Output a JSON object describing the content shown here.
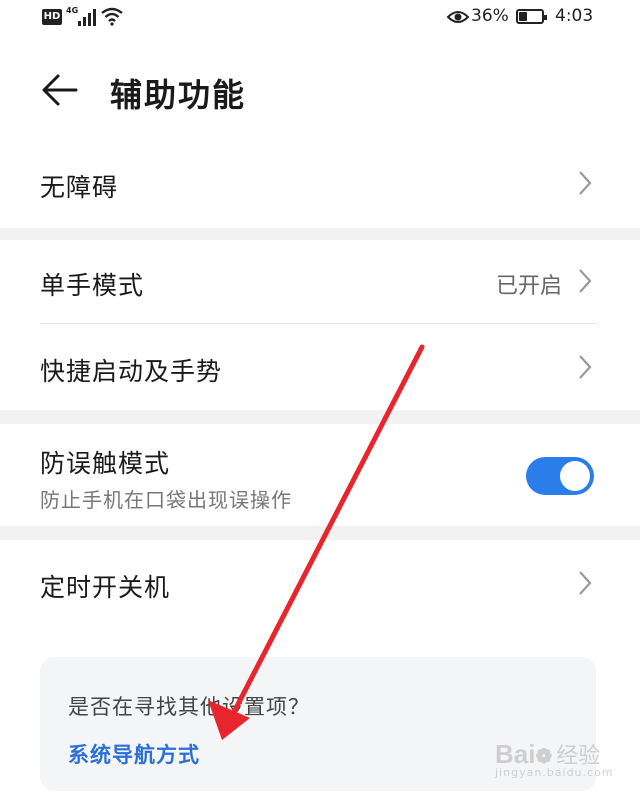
{
  "status_bar": {
    "hd": "HD",
    "network": "4G",
    "battery_percent": "36%",
    "battery_level": 0.36,
    "time": "4:03"
  },
  "header": {
    "title": "辅助功能",
    "back_icon": "arrow-left-icon"
  },
  "items": [
    {
      "label": "无障碍"
    },
    {
      "label": "单手模式",
      "value": "已开启"
    },
    {
      "label": "快捷启动及手势"
    },
    {
      "label": "防误触模式",
      "subtitle": "防止手机在口袋出现误操作",
      "toggle_on": true
    },
    {
      "label": "定时开关机"
    }
  ],
  "suggestion": {
    "question": "是否在寻找其他设置项？",
    "link": "系统导航方式"
  },
  "watermark": {
    "brand": "Bai",
    "brand2": "经验",
    "url": "jingyan.baidu.com"
  },
  "colors": {
    "accent": "#2b7de9",
    "link": "#2b6fd9",
    "arrow": "#e8242c"
  }
}
